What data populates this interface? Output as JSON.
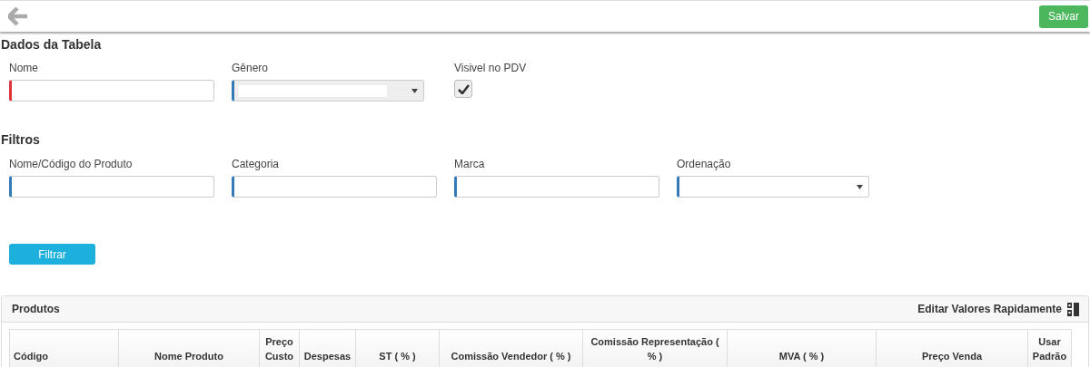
{
  "toolbar": {
    "save_button": "Salvar"
  },
  "dados": {
    "title": "Dados da Tabela",
    "fields": [
      {
        "kind": "text",
        "label": "Nome",
        "required": true
      },
      {
        "kind": "select",
        "label": "Gênero",
        "required": false
      },
      {
        "kind": "checkbox",
        "label": "Visivel no PDV",
        "checked": true
      }
    ]
  },
  "filtros": {
    "title": "Filtros",
    "fields": [
      {
        "kind": "text",
        "label": "Nome/Código do Produto",
        "required": false
      },
      {
        "kind": "text",
        "label": "Categoria",
        "required": false
      },
      {
        "kind": "text",
        "label": "Marca",
        "required": false
      },
      {
        "kind": "select",
        "label": "Ordenação",
        "required": false
      }
    ],
    "button": "Filtrar"
  },
  "produtos": {
    "title": "Produtos",
    "quick_edit": "Editar Valores Rapidamente",
    "columns": [
      "Código",
      "Nome Produto",
      "Preço Custo",
      "Despesas",
      "ST ( % )",
      "Comissão Vendedor ( % )",
      "Comissão Representação ( % )",
      "MVA ( % )",
      "Preço Venda",
      "Usar Padrão"
    ]
  }
}
